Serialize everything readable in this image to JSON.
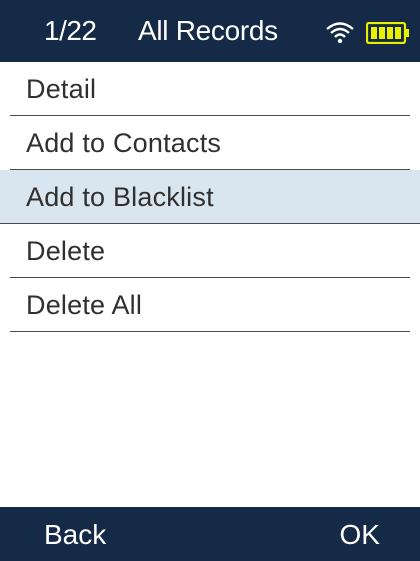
{
  "header": {
    "counter": "1/22",
    "title": "All Records",
    "wifi_icon": "wifi-icon",
    "battery_icon": "battery-icon",
    "background_color": "#142a46",
    "battery_color": "#e8f000"
  },
  "menu": {
    "items": [
      {
        "label": "Detail"
      },
      {
        "label": "Add to Contacts"
      },
      {
        "label": "Add to Blacklist",
        "selected": true
      },
      {
        "label": "Delete"
      },
      {
        "label": "Delete All"
      }
    ],
    "highlight_color": "#d9e5ef"
  },
  "footer": {
    "left_softkey": "Back",
    "right_softkey": "OK"
  }
}
